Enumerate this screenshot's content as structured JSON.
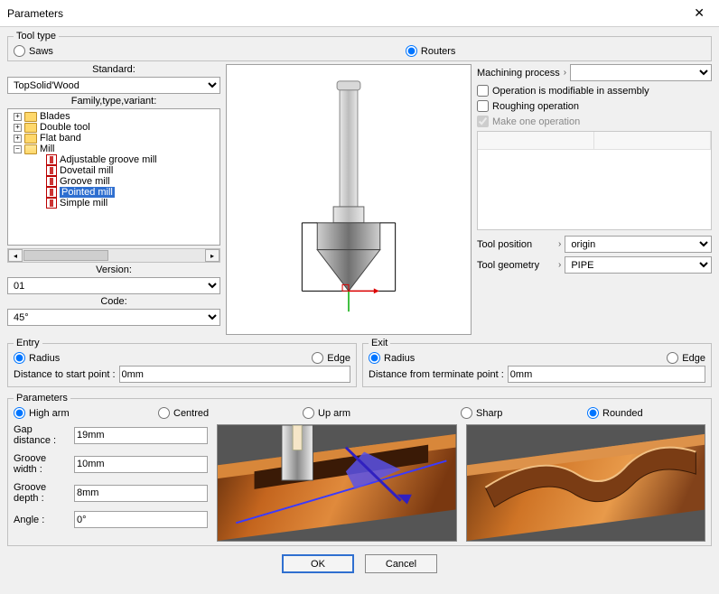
{
  "window": {
    "title": "Parameters"
  },
  "tool_type": {
    "legend": "Tool type",
    "saws": "Saws",
    "routers": "Routers",
    "selected": "routers"
  },
  "standard": {
    "label": "Standard:",
    "value": "TopSolid'Wood"
  },
  "family": {
    "label": "Family,type,variant:"
  },
  "tree": {
    "items": [
      {
        "expand": "+",
        "label": "Blades"
      },
      {
        "expand": "+",
        "label": "Double tool"
      },
      {
        "expand": "+",
        "label": "Flat band"
      },
      {
        "expand": "-",
        "label": "Mill",
        "open": true
      }
    ],
    "mill_children": [
      "Adjustable groove mill",
      "Dovetail mill",
      "Groove mill",
      "Pointed mill",
      "Simple mill"
    ],
    "selected": "Pointed mill"
  },
  "version": {
    "label": "Version:",
    "value": "01"
  },
  "code": {
    "label": "Code:",
    "value": "45°"
  },
  "machining": {
    "process_label": "Machining process",
    "process_value": "",
    "modifiable": "Operation is modifiable in assembly",
    "roughing": "Roughing operation",
    "makeone": "Make one operation",
    "tool_pos_label": "Tool position",
    "tool_pos_value": "origin",
    "tool_geom_label": "Tool geometry",
    "tool_geom_value": "PIPE"
  },
  "entry": {
    "legend": "Entry",
    "radius": "Radius",
    "edge": "Edge",
    "dist_label": "Distance to start point :",
    "dist_value": "0mm"
  },
  "exit": {
    "legend": "Exit",
    "radius": "Radius",
    "edge": "Edge",
    "dist_label": "Distance from terminate point :",
    "dist_value": "0mm"
  },
  "params": {
    "legend": "Parameters",
    "higharm": "High arm",
    "centred": "Centred",
    "uparm": "Up arm",
    "sharp": "Sharp",
    "rounded": "Rounded",
    "gap_label": "Gap distance :",
    "gap_value": "19mm",
    "gw_label": "Groove width :",
    "gw_value": "10mm",
    "gd_label": "Groove depth :",
    "gd_value": "8mm",
    "angle_label": "Angle :",
    "angle_value": "0°"
  },
  "buttons": {
    "ok": "OK",
    "cancel": "Cancel"
  }
}
